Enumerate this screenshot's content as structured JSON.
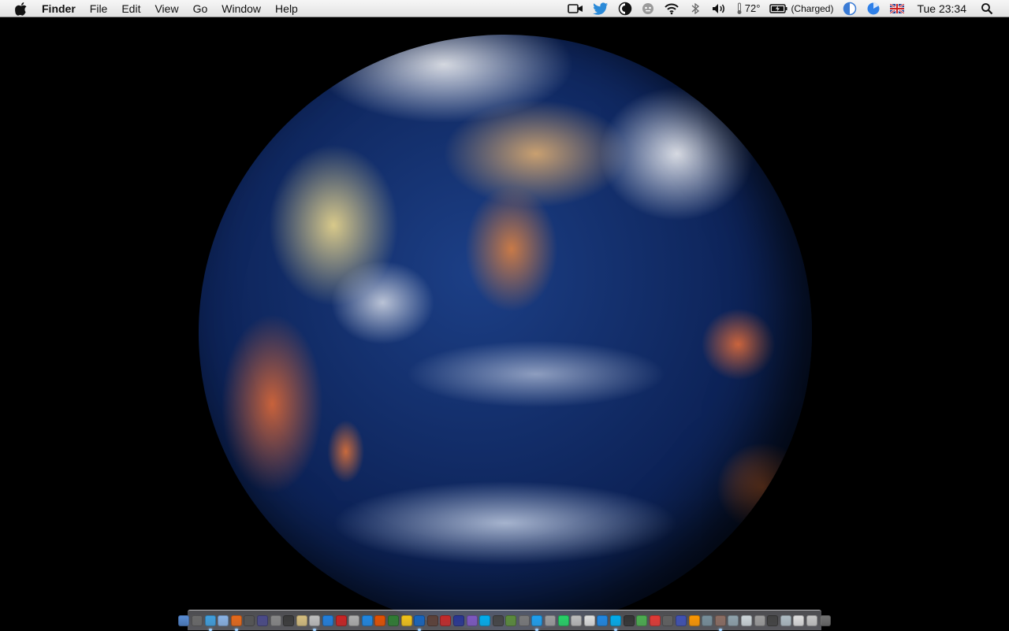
{
  "menubar": {
    "app_name": "Finder",
    "menus": [
      "File",
      "Edit",
      "View",
      "Go",
      "Window",
      "Help"
    ],
    "status": {
      "temperature": "72°",
      "battery": "(Charged)",
      "clock": "Tue 23:34"
    }
  },
  "status_icons": [
    "camera-icon",
    "twitter-icon",
    "contrast-icon",
    "moustache-icon",
    "wifi-icon",
    "bluetooth-icon",
    "volume-icon",
    "thermometer-icon",
    "battery-icon",
    "half-circle-icon",
    "pie-chart-icon",
    "uk-flag-icon",
    "spotlight-search-icon"
  ],
  "dock": {
    "icon_colors": [
      "#5a8ed6",
      "#6a6a6a",
      "#3fa0e0",
      "#8ab4e8",
      "#e86a1a",
      "#555555",
      "#4a4a8a",
      "#888888",
      "#3a3a3a",
      "#d8c080",
      "#c0c0c0",
      "#2080e0",
      "#cc2222",
      "#b0b0b0",
      "#1e88e5",
      "#e65100",
      "#2e7d32",
      "#f5c518",
      "#1565c0",
      "#5d4037",
      "#c62828",
      "#283593",
      "#7e57c2",
      "#00aff0",
      "#444444",
      "#5b8c3a",
      "#7a7a7a",
      "#1da1f2",
      "#9e9e9e",
      "#25d366",
      "#bdbdbd",
      "#e0e0e0",
      "#1e88e5",
      "#00aff0",
      "#333333",
      "#4caf50",
      "#e53935",
      "#616161",
      "#3f51b5",
      "#ff9800",
      "#78909c",
      "#8d6e63",
      "#90a4ae",
      "#cfd8dc",
      "#9e9e9e",
      "#424242",
      "#b0bec5",
      "#e0e0e0",
      "#c8c8c8",
      "#757575"
    ],
    "indicator_positions": [
      2,
      4,
      10,
      18,
      27,
      33,
      41
    ]
  }
}
